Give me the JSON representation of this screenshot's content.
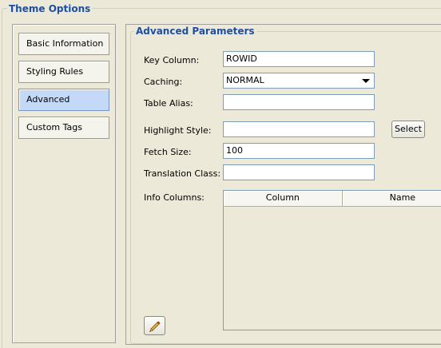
{
  "outer_group": {
    "title": "Theme Options"
  },
  "tabs": [
    {
      "label": "Basic Information",
      "active": false
    },
    {
      "label": "Styling Rules",
      "active": false
    },
    {
      "label": "Advanced",
      "active": true
    },
    {
      "label": "Custom Tags",
      "active": false
    }
  ],
  "advanced": {
    "title": "Advanced Parameters",
    "key_column": {
      "label": "Key Column:",
      "value": "ROWID"
    },
    "caching": {
      "label": "Caching:",
      "value": "NORMAL"
    },
    "table_alias": {
      "label": "Table Alias:",
      "value": ""
    },
    "highlight_style": {
      "label": "Highlight Style:",
      "value": "",
      "button_label": "Select"
    },
    "fetch_size": {
      "label": "Fetch Size:",
      "value": "100"
    },
    "translation_class": {
      "label": "Translation Class:",
      "value": ""
    },
    "info_columns": {
      "label": "Info Columns:",
      "headers": [
        "Column",
        "Name"
      ]
    },
    "edit_button_icon": "pencil-icon"
  },
  "colors": {
    "title_blue": "#1f4fa4",
    "active_tab": "#c4d9f7",
    "background": "#ece9d8",
    "input_border": "#7f9db9"
  }
}
